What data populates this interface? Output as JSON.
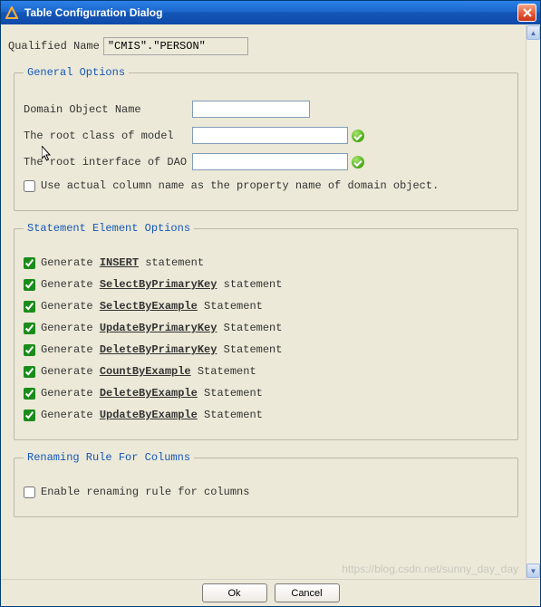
{
  "window": {
    "title": "Table Configuration Dialog"
  },
  "qualified": {
    "label": "Qualified Name",
    "value": "\"CMIS\".\"PERSON\""
  },
  "general": {
    "legend": "General Options",
    "domain_label": "Domain Object Name",
    "domain_value": "",
    "root_class_label": "The root class of model",
    "root_class_value": "",
    "root_iface_label": "The root interface of DAO",
    "root_iface_value": "",
    "actual_col_label": "Use actual column name as the property name of domain object.",
    "actual_col_checked": false
  },
  "statements": {
    "legend": "Statement Element Options",
    "items": [
      {
        "checked": true,
        "pre": "Generate ",
        "kw": "INSERT",
        "post": " statement"
      },
      {
        "checked": true,
        "pre": "Generate ",
        "kw": "SelectByPrimaryKey",
        "post": " statement"
      },
      {
        "checked": true,
        "pre": "Generate ",
        "kw": "SelectByExample",
        "post": " Statement"
      },
      {
        "checked": true,
        "pre": "Generate ",
        "kw": "UpdateByPrimaryKey",
        "post": " Statement"
      },
      {
        "checked": true,
        "pre": "Generate ",
        "kw": "DeleteByPrimaryKey",
        "post": " Statement"
      },
      {
        "checked": true,
        "pre": "Generate ",
        "kw": "CountByExample",
        "post": " Statement"
      },
      {
        "checked": true,
        "pre": "Generate ",
        "kw": "DeleteByExample",
        "post": " Statement"
      },
      {
        "checked": true,
        "pre": "Generate ",
        "kw": "UpdateByExample",
        "post": " Statement"
      }
    ]
  },
  "renaming": {
    "legend": "Renaming Rule For Columns",
    "enable_label": "Enable renaming rule for columns",
    "enable_checked": false
  },
  "buttons": {
    "ok": "Ok",
    "cancel": "Cancel"
  },
  "watermark": "https://blog.csdn.net/sunny_day_day"
}
